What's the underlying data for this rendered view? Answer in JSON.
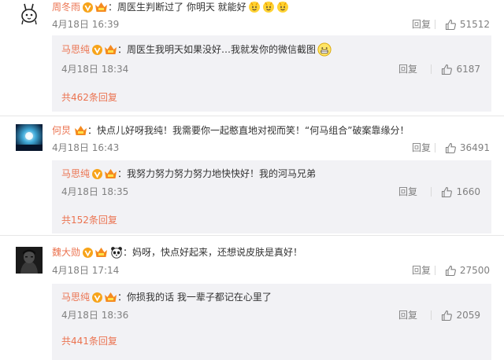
{
  "threads": [
    {
      "user": "周冬雨",
      "text": "周医生判断过了 你明天 就能好",
      "emoji_after": [
        "happy-doll-emoji",
        "happy-doll-emoji",
        "happy-doll-emoji"
      ],
      "date": "4月18日 16:39",
      "reply_label": "回复",
      "likes": "51512",
      "reply": {
        "user": "马思纯",
        "text": "周医生我明天如果没好…我就发你的微信截图",
        "emoji_after": [
          "grin-emoji"
        ],
        "date": "4月18日 18:34",
        "reply_label": "回复",
        "likes": "6187"
      },
      "total_replies": "共462条回复"
    },
    {
      "user": "何炅",
      "text": "快点儿好呀我纯！我需要你一起憨直地对视而笑！“何马组合”破案靠缘分！",
      "emoji_after": [],
      "date": "4月18日 16:43",
      "reply_label": "回复",
      "likes": "36491",
      "reply": {
        "user": "马思纯",
        "text": "我努力努力努力努力地快快好！我的河马兄弟",
        "emoji_after": [],
        "date": "4月18日 18:35",
        "reply_label": "回复",
        "likes": "1660"
      },
      "total_replies": "共152条回复"
    },
    {
      "user": "魏大勋",
      "text": "妈呀，快点好起来，还想说皮肤是真好！",
      "emoji_after": [],
      "date": "4月18日 17:14",
      "reply_label": "回复",
      "likes": "27500",
      "reply": {
        "user": "马思纯",
        "text": "你损我的话 我一辈子都记在心里了",
        "emoji_after": [],
        "date": "4月18日 18:36",
        "reply_label": "回复",
        "likes": "2059"
      },
      "total_replies": "共441条回复"
    }
  ],
  "colors": {
    "name": "#eb7350",
    "text": "#333333",
    "meta": "#808080",
    "reply_bg": "#f2f2f5",
    "divider": "#e6e6e6"
  }
}
